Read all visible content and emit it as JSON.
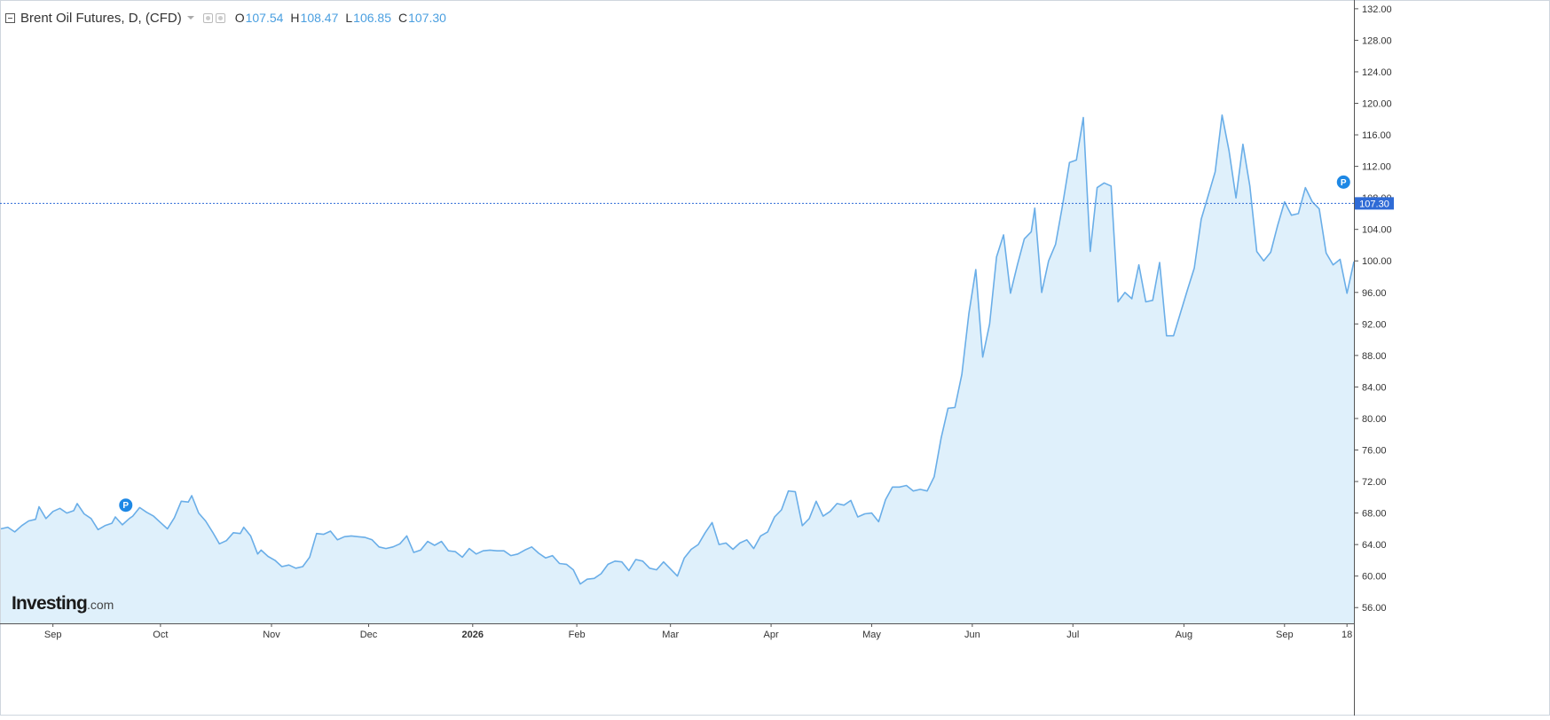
{
  "header": {
    "title": "Brent Oil Futures, D, (CFD)",
    "ohlc": [
      {
        "key": "O",
        "value": "107.54"
      },
      {
        "key": "H",
        "value": "108.47"
      },
      {
        "key": "L",
        "value": "106.85"
      },
      {
        "key": "C",
        "value": "107.30"
      }
    ],
    "icons": [
      "collapse-icon",
      "caret-down-icon",
      "settings-icon",
      "gear-icon"
    ]
  },
  "logo": {
    "main": "Investing",
    "suffix": ".com"
  },
  "colors": {
    "line": "#6aaee8",
    "area": "#dff0fb",
    "price_line": "#2f6bd6",
    "price_label_bg": "#2f6bd6",
    "marker": "#1e88e5",
    "text": "#333333"
  },
  "chart_data": {
    "type": "area",
    "title": "Brent Oil Futures, D, (CFD)",
    "ylim": [
      54,
      133
    ],
    "y_ticks": [
      "56.00",
      "60.00",
      "64.00",
      "68.00",
      "72.00",
      "76.00",
      "80.00",
      "84.00",
      "88.00",
      "92.00",
      "96.00",
      "100.00",
      "104.00",
      "108.00",
      "112.00",
      "116.00",
      "120.00",
      "124.00",
      "128.00",
      "132.00"
    ],
    "x_tick_labels": [
      {
        "label": "Sep",
        "t": 10,
        "bold": false
      },
      {
        "label": "Oct",
        "t": 41,
        "bold": false
      },
      {
        "label": "Nov",
        "t": 73,
        "bold": false
      },
      {
        "label": "Dec",
        "t": 101,
        "bold": false
      },
      {
        "label": "2026",
        "t": 131,
        "bold": true
      },
      {
        "label": "Feb",
        "t": 161,
        "bold": false
      },
      {
        "label": "Mar",
        "t": 188,
        "bold": false
      },
      {
        "label": "Apr",
        "t": 217,
        "bold": false
      },
      {
        "label": "May",
        "t": 246,
        "bold": false
      },
      {
        "label": "Jun",
        "t": 275,
        "bold": false
      },
      {
        "label": "Jul",
        "t": 304,
        "bold": false
      },
      {
        "label": "Aug",
        "t": 336,
        "bold": false
      },
      {
        "label": "Sep",
        "t": 365,
        "bold": false
      },
      {
        "label": "18",
        "t": 383,
        "bold": false
      }
    ],
    "x_range": [
      -5,
      385
    ],
    "series": [
      {
        "values": [
          [
            -5,
            66.0
          ],
          [
            -3,
            66.2
          ],
          [
            -1,
            65.6
          ],
          [
            1,
            66.4
          ],
          [
            3,
            67.0
          ],
          [
            5,
            67.2
          ],
          [
            6,
            68.8
          ],
          [
            8,
            67.3
          ],
          [
            10,
            68.2
          ],
          [
            12,
            68.6
          ],
          [
            14,
            68.0
          ],
          [
            16,
            68.3
          ],
          [
            17,
            69.2
          ],
          [
            19,
            67.9
          ],
          [
            21,
            67.3
          ],
          [
            23,
            65.9
          ],
          [
            25,
            66.4
          ],
          [
            27,
            66.7
          ],
          [
            28,
            67.5
          ],
          [
            30,
            66.5
          ],
          [
            32,
            67.3
          ],
          [
            33,
            67.6
          ],
          [
            35,
            68.7
          ],
          [
            37,
            68.1
          ],
          [
            39,
            67.6
          ],
          [
            41,
            66.8
          ],
          [
            43,
            66.0
          ],
          [
            45,
            67.4
          ],
          [
            47,
            69.5
          ],
          [
            49,
            69.4
          ],
          [
            50,
            70.2
          ],
          [
            52,
            68.0
          ],
          [
            54,
            67.0
          ],
          [
            56,
            65.6
          ],
          [
            58,
            64.1
          ],
          [
            60,
            64.5
          ],
          [
            62,
            65.5
          ],
          [
            64,
            65.4
          ],
          [
            65,
            66.2
          ],
          [
            67,
            65.1
          ],
          [
            69,
            62.8
          ],
          [
            70,
            63.3
          ],
          [
            72,
            62.5
          ],
          [
            74,
            62.0
          ],
          [
            76,
            61.2
          ],
          [
            78,
            61.4
          ],
          [
            80,
            61.0
          ],
          [
            82,
            61.2
          ],
          [
            84,
            62.4
          ],
          [
            86,
            65.4
          ],
          [
            88,
            65.3
          ],
          [
            90,
            65.7
          ],
          [
            92,
            64.6
          ],
          [
            94,
            65.0
          ],
          [
            96,
            65.1
          ],
          [
            98,
            65.0
          ],
          [
            100,
            64.9
          ],
          [
            102,
            64.6
          ],
          [
            104,
            63.7
          ],
          [
            106,
            63.5
          ],
          [
            108,
            63.7
          ],
          [
            110,
            64.1
          ],
          [
            112,
            65.1
          ],
          [
            114,
            63.0
          ],
          [
            116,
            63.3
          ],
          [
            118,
            64.4
          ],
          [
            120,
            63.9
          ],
          [
            122,
            64.4
          ],
          [
            124,
            63.2
          ],
          [
            126,
            63.1
          ],
          [
            128,
            62.4
          ],
          [
            130,
            63.5
          ],
          [
            132,
            62.8
          ],
          [
            134,
            63.2
          ],
          [
            136,
            63.3
          ],
          [
            138,
            63.2
          ],
          [
            140,
            63.2
          ],
          [
            142,
            62.6
          ],
          [
            144,
            62.8
          ],
          [
            146,
            63.3
          ],
          [
            148,
            63.7
          ],
          [
            150,
            62.9
          ],
          [
            152,
            62.3
          ],
          [
            154,
            62.6
          ],
          [
            156,
            61.6
          ],
          [
            158,
            61.5
          ],
          [
            160,
            60.8
          ],
          [
            162,
            59.0
          ],
          [
            164,
            59.6
          ],
          [
            166,
            59.7
          ],
          [
            168,
            60.3
          ],
          [
            170,
            61.5
          ],
          [
            172,
            61.9
          ],
          [
            174,
            61.8
          ],
          [
            176,
            60.7
          ],
          [
            178,
            62.1
          ],
          [
            180,
            61.9
          ],
          [
            182,
            61.0
          ],
          [
            184,
            60.8
          ],
          [
            186,
            61.8
          ],
          [
            188,
            60.9
          ],
          [
            190,
            60.0
          ],
          [
            192,
            62.3
          ],
          [
            194,
            63.4
          ],
          [
            196,
            64.0
          ],
          [
            198,
            65.5
          ],
          [
            200,
            66.8
          ],
          [
            202,
            64.0
          ],
          [
            204,
            64.2
          ],
          [
            206,
            63.4
          ],
          [
            208,
            64.2
          ],
          [
            210,
            64.6
          ],
          [
            212,
            63.5
          ],
          [
            214,
            65.1
          ],
          [
            216,
            65.6
          ],
          [
            218,
            67.5
          ],
          [
            220,
            68.4
          ],
          [
            222,
            70.8
          ],
          [
            224,
            70.7
          ],
          [
            226,
            66.4
          ],
          [
            228,
            67.3
          ],
          [
            230,
            69.5
          ],
          [
            232,
            67.6
          ],
          [
            234,
            68.2
          ],
          [
            236,
            69.2
          ],
          [
            238,
            69.0
          ],
          [
            240,
            69.6
          ],
          [
            242,
            67.5
          ],
          [
            244,
            67.9
          ],
          [
            246,
            68.0
          ],
          [
            248,
            66.9
          ],
          [
            250,
            69.7
          ],
          [
            252,
            71.3
          ],
          [
            254,
            71.3
          ],
          [
            256,
            71.5
          ],
          [
            258,
            70.8
          ],
          [
            260,
            71.0
          ],
          [
            262,
            70.8
          ],
          [
            264,
            72.6
          ],
          [
            266,
            77.5
          ],
          [
            268,
            81.3
          ],
          [
            270,
            81.4
          ],
          [
            272,
            85.6
          ],
          [
            274,
            93.3
          ],
          [
            276,
            98.9
          ],
          [
            278,
            87.8
          ],
          [
            280,
            92.0
          ],
          [
            282,
            100.5
          ],
          [
            284,
            103.3
          ],
          [
            286,
            95.9
          ],
          [
            288,
            99.5
          ],
          [
            290,
            102.8
          ],
          [
            292,
            103.7
          ],
          [
            293,
            106.7
          ],
          [
            295,
            96.0
          ],
          [
            297,
            100.0
          ],
          [
            299,
            102.1
          ],
          [
            301,
            107.0
          ],
          [
            303,
            112.5
          ],
          [
            305,
            112.8
          ],
          [
            307,
            118.2
          ],
          [
            309,
            101.2
          ],
          [
            311,
            109.3
          ],
          [
            313,
            109.9
          ],
          [
            315,
            109.5
          ],
          [
            317,
            94.8
          ],
          [
            319,
            96.0
          ],
          [
            321,
            95.2
          ],
          [
            323,
            99.5
          ],
          [
            325,
            94.8
          ],
          [
            327,
            95.0
          ],
          [
            329,
            99.8
          ],
          [
            331,
            90.5
          ],
          [
            333,
            90.5
          ],
          [
            335,
            93.4
          ],
          [
            337,
            96.3
          ],
          [
            339,
            99.1
          ],
          [
            341,
            105.3
          ],
          [
            343,
            108.3
          ],
          [
            345,
            111.3
          ],
          [
            347,
            118.5
          ],
          [
            349,
            114.0
          ],
          [
            351,
            108.0
          ],
          [
            353,
            114.8
          ],
          [
            355,
            109.5
          ],
          [
            357,
            101.2
          ],
          [
            359,
            100.0
          ],
          [
            361,
            101.1
          ],
          [
            363,
            104.5
          ],
          [
            365,
            107.5
          ],
          [
            367,
            105.8
          ],
          [
            369,
            106.0
          ],
          [
            371,
            109.3
          ],
          [
            373,
            107.5
          ],
          [
            375,
            106.6
          ],
          [
            377,
            101.0
          ],
          [
            379,
            99.5
          ],
          [
            381,
            100.2
          ],
          [
            383,
            95.9
          ],
          [
            385,
            99.9
          ]
        ]
      }
    ]
  }
}
